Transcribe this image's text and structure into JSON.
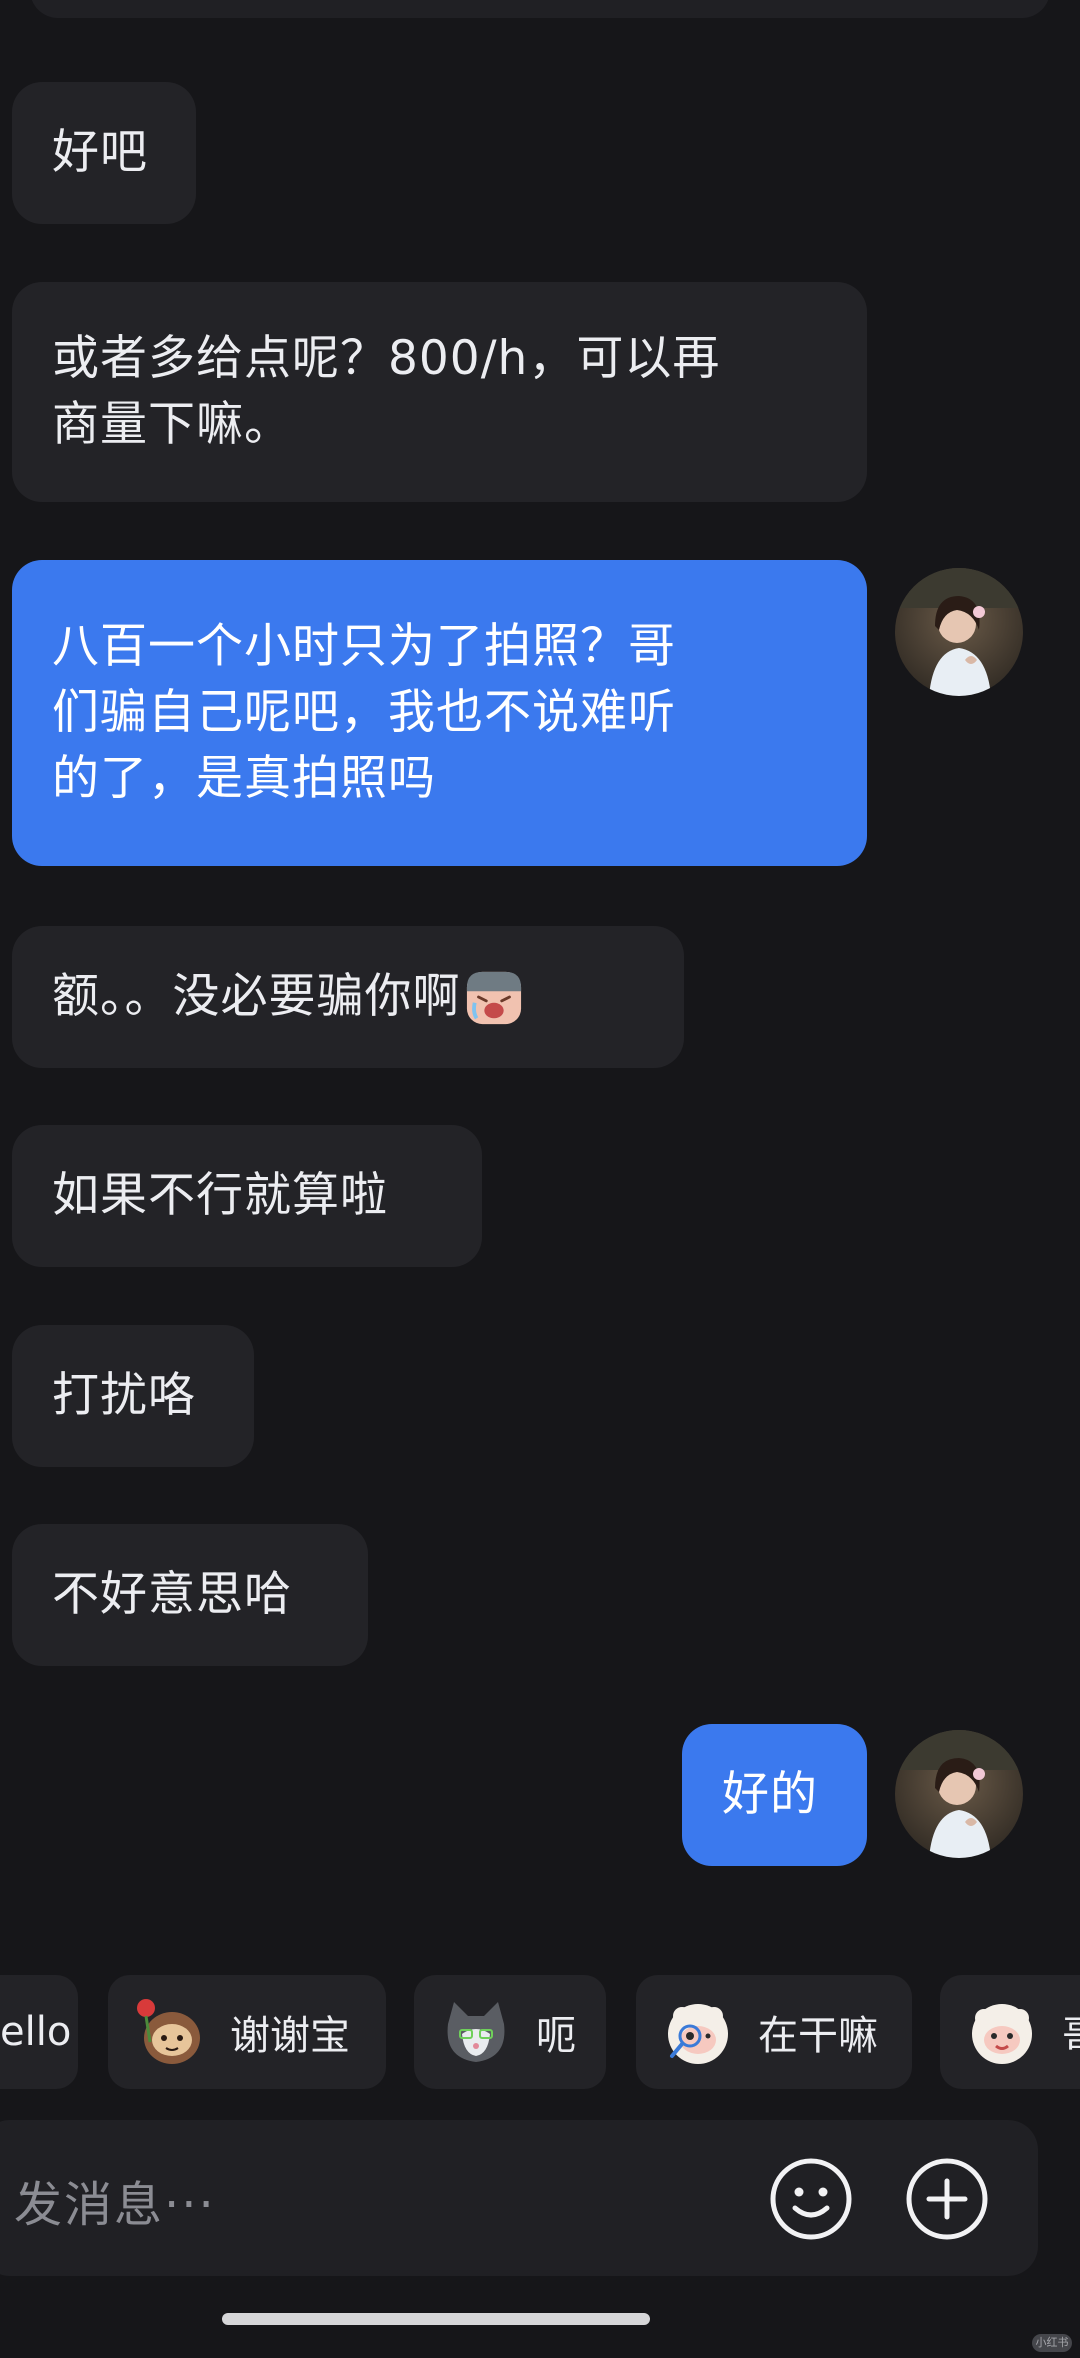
{
  "messages": [
    {
      "side": "in",
      "lines": [
        "好吧"
      ]
    },
    {
      "side": "in",
      "lines": [
        "或者多给点呢？800/h，可以再",
        "商量下嘛。"
      ]
    },
    {
      "side": "out",
      "lines": [
        "八百一个小时只为了拍照？哥",
        "们骗自己呢吧，我也不说难听",
        "的了，是真拍照吗"
      ]
    },
    {
      "side": "in",
      "lines": [
        "额。。没必要骗你啊"
      ],
      "emoji": "crying-face-emoji"
    },
    {
      "side": "in",
      "lines": [
        "如果不行就算啦"
      ]
    },
    {
      "side": "in",
      "lines": [
        "打扰咯"
      ]
    },
    {
      "side": "in",
      "lines": [
        "不好意思哈"
      ]
    },
    {
      "side": "out",
      "lines": [
        "好的"
      ]
    }
  ],
  "quick_stickers": [
    {
      "label": "ello",
      "icon": ""
    },
    {
      "label": "谢谢宝",
      "icon": "sloth-rose-sticker"
    },
    {
      "label": "呃",
      "icon": "cat-sticker"
    },
    {
      "label": "在干嘛",
      "icon": "sheep-magnifier-sticker"
    },
    {
      "label": "哥",
      "icon": "sheep-sticker"
    }
  ],
  "composer": {
    "placeholder": "发消息···",
    "emoji_button_icon": "smile-icon",
    "plus_button_icon": "plus-icon"
  },
  "watermark": "小红书",
  "colors": {
    "background": "#161619",
    "incoming_bubble": "#232327",
    "outgoing_bubble": "#3b79ee"
  }
}
